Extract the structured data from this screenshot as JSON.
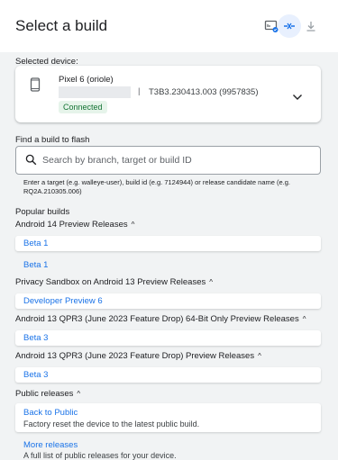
{
  "header": {
    "title": "Select a build",
    "icons": [
      "device-link-icon",
      "disconnect-icon",
      "download-icon"
    ]
  },
  "device": {
    "section_label": "Selected device:",
    "name": "Pixel 6 (oriole)",
    "separator": "|",
    "build_id": "T3B3.230413.003 (9957835)",
    "status": "Connected"
  },
  "search": {
    "label": "Find a build to flash",
    "placeholder": "Search by branch, target or build ID",
    "hint": "Enter a target (e.g. walleye-user), build id (e.g. 7124944) or release candidate name (e.g. RQ2A.210305.006)"
  },
  "popular": {
    "label": "Popular builds",
    "groups": [
      {
        "title": "Android 14 Preview Releases",
        "items": [
          "Beta 1",
          "Beta 1"
        ]
      },
      {
        "title": "Privacy Sandbox on Android 13 Preview Releases",
        "items": [
          "Developer Preview 6"
        ]
      },
      {
        "title": "Android 13 QPR3 (June 2023 Feature Drop) 64-Bit Only Preview Releases",
        "items": [
          "Beta 3"
        ]
      },
      {
        "title": "Android 13 QPR3 (June 2023 Feature Drop) Preview Releases",
        "items": [
          "Beta 3"
        ]
      }
    ]
  },
  "public": {
    "title": "Public releases",
    "items": [
      {
        "label": "Back to Public",
        "desc": "Factory reset the device to the latest public build."
      },
      {
        "label": "More releases",
        "desc": "A full list of public releases for your device."
      }
    ]
  },
  "colors": {
    "accent": "#1a73e8",
    "connected_bg": "#e6f4ea",
    "connected_fg": "#137333"
  }
}
